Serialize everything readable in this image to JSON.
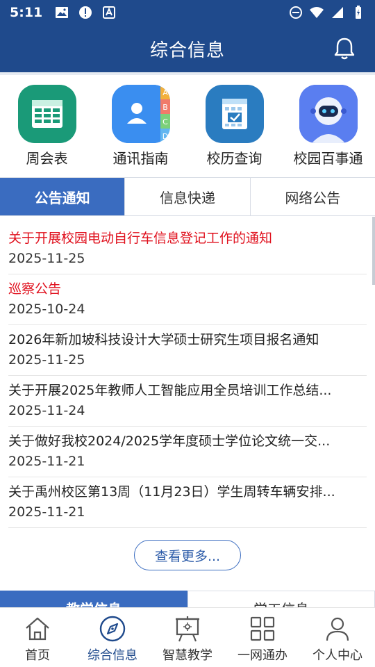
{
  "status_bar": {
    "time": "5:11"
  },
  "header": {
    "title": "综合信息"
  },
  "shortcuts": [
    {
      "label": "周会表",
      "icon": "spreadsheet-icon",
      "color": "#1a9a78"
    },
    {
      "label": "通讯指南",
      "icon": "contacts-icon",
      "color": "#3a8ef0",
      "tab_letters": [
        "A",
        "B",
        "C",
        "D"
      ]
    },
    {
      "label": "校历查询",
      "icon": "calendar-icon",
      "color": "#2a7cc0"
    },
    {
      "label": "校园百事通",
      "icon": "robot-icon",
      "color": "#4a6ce0"
    }
  ],
  "news_tabs": [
    {
      "label": "公告通知",
      "active": true
    },
    {
      "label": "信息快递",
      "active": false
    },
    {
      "label": "网络公告",
      "active": false
    }
  ],
  "news": [
    {
      "title": "关于开展校园电动自行车信息登记工作的通知",
      "date": "2025-11-25",
      "highlight": true
    },
    {
      "title": "巡察公告",
      "date": "2025-10-24",
      "highlight": true
    },
    {
      "title": "2026年新加坡科技设计大学硕士研究生项目报名通知",
      "date": "2025-11-25",
      "highlight": false
    },
    {
      "title": "关于开展2025年教师人工智能应用全员培训工作总结...",
      "date": "2025-11-24",
      "highlight": false
    },
    {
      "title": "关于做好我校2024/2025学年度硕士学位论文统一交...",
      "date": "2025-11-21",
      "highlight": false
    },
    {
      "title": "关于禹州校区第13周（11月23日）学生周转车辆安排...",
      "date": "2025-11-21",
      "highlight": false
    }
  ],
  "more_label": "查看更多...",
  "section_tabs": [
    {
      "label": "教学信息",
      "active": true
    },
    {
      "label": "学工信息",
      "active": false
    }
  ],
  "bottom_nav": [
    {
      "label": "首页",
      "icon": "home-icon",
      "active": false
    },
    {
      "label": "综合信息",
      "icon": "compass-icon",
      "active": true
    },
    {
      "label": "智慧教学",
      "icon": "easel-icon",
      "active": false
    },
    {
      "label": "一网通办",
      "icon": "grid-icon",
      "active": false
    },
    {
      "label": "个人中心",
      "icon": "user-icon",
      "active": false
    }
  ],
  "colors": {
    "primary": "#1f4a8c",
    "accent": "#3a6cc0",
    "highlight": "#e0101d"
  }
}
